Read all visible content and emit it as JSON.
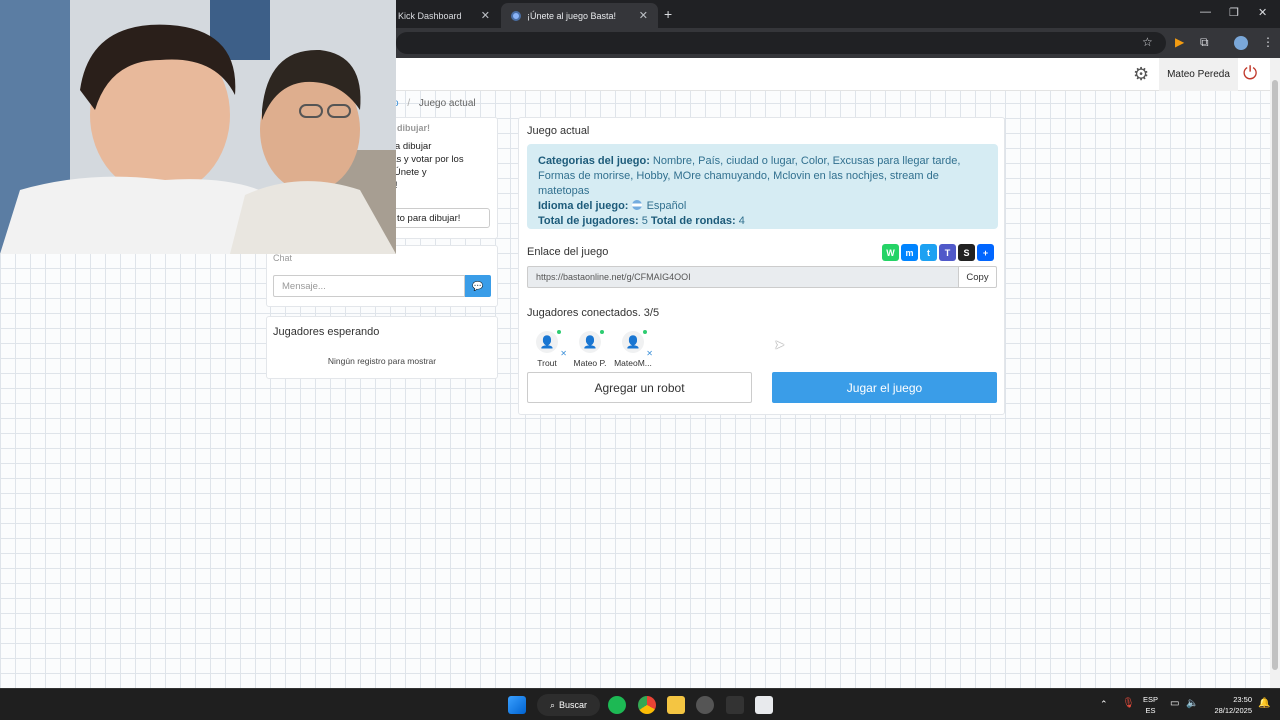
{
  "browser": {
    "tabs": [
      {
        "label": "Kick Dashboard",
        "active": false
      },
      {
        "label": "¡Únete al juego Basta!",
        "active": true
      }
    ]
  },
  "navbar": {
    "username": "Mateo Pereda"
  },
  "breadcrumb": {
    "parent": "vo",
    "separator": "/",
    "current": "Juego actual"
  },
  "sidebar": {
    "instructions_title": "dibujar!",
    "instructions_lines": [
      "e reta a dibujar",
      "vertidas y votar por los",
      "ujos. ¡Únete y",
      "tu arte!"
    ],
    "sketch_button": "to para dibujar!",
    "chat_label": "Chat",
    "chat_placeholder": "Mensaje...",
    "waiting_title": "Jugadores esperando",
    "waiting_empty": "Ningún registro para mostrar"
  },
  "game": {
    "title": "Juego actual",
    "categories_label": "Categorias del juego:",
    "categories_value": "Nombre, País, ciudad o lugar, Color, Excusas para llegar tarde, Formas de morirse, Hobby, MOre chamuyando, Mclovin en las nochjes, stream de matetopas",
    "language_label": "Idioma del juego:",
    "language_value": "Español",
    "players_total_label": "Total de jugadores:",
    "players_total_value": "5",
    "rounds_total_label": "Total de rondas:",
    "rounds_total_value": "4",
    "link_label": "Enlace del juego",
    "link_value": "https://bastaonline.net/g/CFMAIG4OOI",
    "copy_label": "Copy",
    "connected_label": "Jugadores conectados. 3/5",
    "players": [
      {
        "name": "Trout",
        "icon": "user-outline-icon"
      },
      {
        "name": "Mateo P.",
        "icon": "user-star-icon"
      },
      {
        "name": "MateoM...",
        "icon": "user-icon"
      }
    ],
    "add_robot_label": "Agregar un robot",
    "play_label": "Jugar el juego"
  },
  "share_icons": [
    "whatsapp-icon",
    "messenger-icon",
    "twitter-icon",
    "teams-icon",
    "snapchat-icon",
    "plus-icon"
  ],
  "taskbar": {
    "search_label": "Buscar",
    "lang_top": "ESP",
    "lang_bottom": "ES",
    "time": "23:50",
    "date": "28/12/2025"
  },
  "colors": {
    "accent": "#3a9de8",
    "info_bg": "#d6ecf3",
    "info_text": "#31708f"
  }
}
